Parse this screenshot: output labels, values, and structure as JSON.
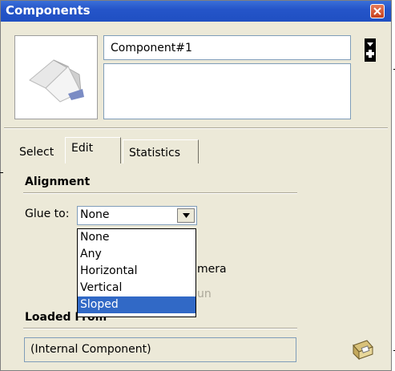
{
  "window": {
    "title": "Components"
  },
  "component": {
    "name": "Component#1",
    "description": ""
  },
  "tabs": [
    {
      "label": "Select",
      "active": false
    },
    {
      "label": "Edit",
      "active": true
    },
    {
      "label": "Statistics",
      "active": false
    }
  ],
  "alignment": {
    "heading": "Alignment",
    "glue_label": "Glue to:",
    "glue_value": "None",
    "options": [
      "None",
      "Any",
      "Horizontal",
      "Vertical",
      "Sloped"
    ],
    "highlighted_option": "Sloped",
    "partial_camera_text": "mera",
    "partial_sun_text": "un"
  },
  "loaded_from": {
    "heading": "Loaded From",
    "value": "(Internal Component)"
  },
  "icons": {
    "close": "close-icon",
    "details": "details-arrow-icon",
    "open_folder": "open-folder-icon",
    "dropdown": "chevron-down-icon"
  },
  "colors": {
    "title_bar": "#2555c9",
    "dialog_bg": "#ece9d8",
    "highlight": "#3169c6",
    "close_button": "#c6401d"
  }
}
